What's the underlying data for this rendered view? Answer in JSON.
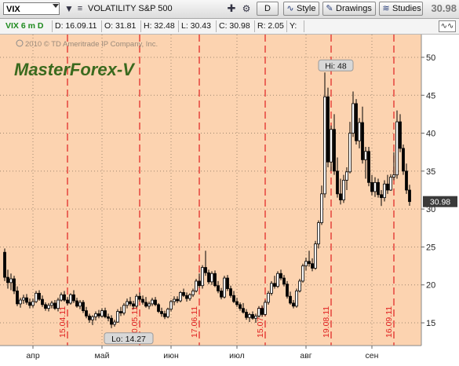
{
  "toolbar": {
    "symbol": "VIX",
    "description": "VOLATILITY S&P 500",
    "period_button": "D",
    "style_label": "Style",
    "drawings_label": "Drawings",
    "studies_label": "Studies",
    "last_price": "30.98"
  },
  "infobar": {
    "symbol_period": "VIX 6 m D",
    "date": "D: 16.09.11",
    "open": "O: 31.81",
    "high": "H: 32.48",
    "low": "L: 30.43",
    "close": "C: 30.98",
    "range": "R: 2.05",
    "y": "Y:"
  },
  "chart": {
    "copyright": "2010 © TD Ameritrade IP Company, Inc.",
    "watermark": "MasterForex-V",
    "colors": {
      "background": "#fcd3b0",
      "up": "#ffffff",
      "down": "#000000",
      "marker": "#e02020",
      "grid": "#a08870"
    },
    "y_ticks": [
      15,
      20,
      25,
      30,
      35,
      40,
      45,
      50
    ],
    "x_month_labels": [
      "апр",
      "май",
      "июн",
      "июл",
      "авг",
      "сен"
    ],
    "date_markers": [
      "15.04.11",
      "20.05.11",
      "17.06.11",
      "15.07.11",
      "19.08.11",
      "16.09.11"
    ],
    "high_label": "Hi: 48",
    "low_label": "Lo: 14.27",
    "price_tag": "30.98"
  },
  "chart_data": {
    "type": "candlestick",
    "ylim": [
      12,
      53
    ],
    "y_ticks": [
      15,
      20,
      25,
      30,
      35,
      40,
      45,
      50
    ],
    "x_labels": [
      "апр",
      "май",
      "июн",
      "июл",
      "авг",
      "сен"
    ],
    "series": [
      {
        "values": [
          [
            24.3,
            24.8,
            20.5,
            21.0
          ],
          [
            21.0,
            22.0,
            19.5,
            20.3
          ],
          [
            20.3,
            21.5,
            19.3,
            20.8
          ],
          [
            20.8,
            21.2,
            18.8,
            19.2
          ],
          [
            19.2,
            19.8,
            17.2,
            17.5
          ],
          [
            17.5,
            18.3,
            17.0,
            18.0
          ],
          [
            18.0,
            18.7,
            17.5,
            18.3
          ],
          [
            18.3,
            18.8,
            17.4,
            17.7
          ],
          [
            17.7,
            18.2,
            16.9,
            17.3
          ],
          [
            17.3,
            18.2,
            17.0,
            17.8
          ],
          [
            17.8,
            19.2,
            17.6,
            18.9
          ],
          [
            18.9,
            19.3,
            17.9,
            18.1
          ],
          [
            18.1,
            18.6,
            17.1,
            17.4
          ],
          [
            17.4,
            17.7,
            16.6,
            16.9
          ],
          [
            16.9,
            17.6,
            16.5,
            17.3
          ],
          [
            17.3,
            17.9,
            16.9,
            17.6
          ],
          [
            17.6,
            18.0,
            16.7,
            16.9
          ],
          [
            16.9,
            18.3,
            16.5,
            18.0
          ],
          [
            18.0,
            19.0,
            17.8,
            18.7
          ],
          [
            18.7,
            19.2,
            17.8,
            18.0
          ],
          [
            18.0,
            18.4,
            17.3,
            17.6
          ],
          [
            17.6,
            18.9,
            17.4,
            18.7
          ],
          [
            18.7,
            19.3,
            17.6,
            17.9
          ],
          [
            17.9,
            18.3,
            17.0,
            17.2
          ],
          [
            17.2,
            18.0,
            16.8,
            17.7
          ],
          [
            17.7,
            18.0,
            16.3,
            16.6
          ],
          [
            16.6,
            17.1,
            15.6,
            15.9
          ],
          [
            15.9,
            16.2,
            15.0,
            15.4
          ],
          [
            15.4,
            16.0,
            14.7,
            15.8
          ],
          [
            15.8,
            16.5,
            15.3,
            16.2
          ],
          [
            16.2,
            16.7,
            15.6,
            15.9
          ],
          [
            15.9,
            16.9,
            15.7,
            16.6
          ],
          [
            16.6,
            17.0,
            15.6,
            15.8
          ],
          [
            15.8,
            16.2,
            15.2,
            15.6
          ],
          [
            15.6,
            16.0,
            14.3,
            14.8
          ],
          [
            14.8,
            15.4,
            14.5,
            15.1
          ],
          [
            15.1,
            16.8,
            15.0,
            16.5
          ],
          [
            16.5,
            17.1,
            15.9,
            16.3
          ],
          [
            16.3,
            17.6,
            16.0,
            17.3
          ],
          [
            17.3,
            18.2,
            16.9,
            17.8
          ],
          [
            17.8,
            18.4,
            17.2,
            17.5
          ],
          [
            17.5,
            17.9,
            16.8,
            17.2
          ],
          [
            17.2,
            18.8,
            17.0,
            18.5
          ],
          [
            18.5,
            19.0,
            17.8,
            18.1
          ],
          [
            18.1,
            18.6,
            17.4,
            17.7
          ],
          [
            17.7,
            18.4,
            17.0,
            17.2
          ],
          [
            17.2,
            17.8,
            16.8,
            17.5
          ],
          [
            17.5,
            18.3,
            17.2,
            18.0
          ],
          [
            18.0,
            18.4,
            17.2,
            17.4
          ],
          [
            17.4,
            17.6,
            16.3,
            16.5
          ],
          [
            16.5,
            17.0,
            15.8,
            16.2
          ],
          [
            16.2,
            16.6,
            15.5,
            15.8
          ],
          [
            15.8,
            17.0,
            15.6,
            16.8
          ],
          [
            16.8,
            18.0,
            16.5,
            17.8
          ],
          [
            17.8,
            18.5,
            17.3,
            18.1
          ],
          [
            18.1,
            18.5,
            17.6,
            17.9
          ],
          [
            17.9,
            19.2,
            17.7,
            19.0
          ],
          [
            19.0,
            19.5,
            18.4,
            18.6
          ],
          [
            18.6,
            19.0,
            17.8,
            18.2
          ],
          [
            18.2,
            18.9,
            17.9,
            18.7
          ],
          [
            18.7,
            19.5,
            18.4,
            19.2
          ],
          [
            19.2,
            20.8,
            19.0,
            20.5
          ],
          [
            20.5,
            21.5,
            19.6,
            19.9
          ],
          [
            19.9,
            22.6,
            19.5,
            22.3
          ],
          [
            22.3,
            24.5,
            21.2,
            21.6
          ],
          [
            21.6,
            22.0,
            20.1,
            20.4
          ],
          [
            20.4,
            21.8,
            20.0,
            21.5
          ],
          [
            21.5,
            21.9,
            19.7,
            19.9
          ],
          [
            19.9,
            20.5,
            18.9,
            19.2
          ],
          [
            19.2,
            19.6,
            18.1,
            18.4
          ],
          [
            18.4,
            21.2,
            18.2,
            20.9
          ],
          [
            20.9,
            21.3,
            19.2,
            19.5
          ],
          [
            19.5,
            19.9,
            18.3,
            18.6
          ],
          [
            18.6,
            19.2,
            17.6,
            17.8
          ],
          [
            17.8,
            18.3,
            17.1,
            17.4
          ],
          [
            17.4,
            17.7,
            16.6,
            16.9
          ],
          [
            16.9,
            17.6,
            16.2,
            16.4
          ],
          [
            16.4,
            16.8,
            15.4,
            15.7
          ],
          [
            15.7,
            16.3,
            15.1,
            16.1
          ],
          [
            16.1,
            16.5,
            15.4,
            15.6
          ],
          [
            15.6,
            16.2,
            15.0,
            15.9
          ],
          [
            15.9,
            17.2,
            15.7,
            16.9
          ],
          [
            16.9,
            17.3,
            15.8,
            16.1
          ],
          [
            16.1,
            18.0,
            15.9,
            17.7
          ],
          [
            17.7,
            19.2,
            17.4,
            18.9
          ],
          [
            18.9,
            20.5,
            18.6,
            20.2
          ],
          [
            20.2,
            21.2,
            19.5,
            19.8
          ],
          [
            19.8,
            21.8,
            19.6,
            21.5
          ],
          [
            21.5,
            22.0,
            20.6,
            20.9
          ],
          [
            20.9,
            21.3,
            19.8,
            20.1
          ],
          [
            20.1,
            20.5,
            18.2,
            18.5
          ],
          [
            18.5,
            19.1,
            17.4,
            17.6
          ],
          [
            17.6,
            18.0,
            16.9,
            17.2
          ],
          [
            17.2,
            19.5,
            17.0,
            19.2
          ],
          [
            19.2,
            20.8,
            19.0,
            20.5
          ],
          [
            20.5,
            22.8,
            20.3,
            22.5
          ],
          [
            22.5,
            23.6,
            21.9,
            23.1
          ],
          [
            23.1,
            24.5,
            22.4,
            22.8
          ],
          [
            22.8,
            23.5,
            21.8,
            22.2
          ],
          [
            22.2,
            25.8,
            22.0,
            25.4
          ],
          [
            25.4,
            28.5,
            24.8,
            28.2
          ],
          [
            28.2,
            33.1,
            27.9,
            32.0
          ],
          [
            32.0,
            48.0,
            31.5,
            44.8
          ],
          [
            44.8,
            46.0,
            35.5,
            36.2
          ],
          [
            36.2,
            41.0,
            35.0,
            40.5
          ],
          [
            40.5,
            42.5,
            34.5,
            35.0
          ],
          [
            35.0,
            36.8,
            31.5,
            32.0
          ],
          [
            32.0,
            34.0,
            30.6,
            31.2
          ],
          [
            31.2,
            34.5,
            30.8,
            33.8
          ],
          [
            33.8,
            35.5,
            32.5,
            34.9
          ],
          [
            34.9,
            41.5,
            34.7,
            40.0
          ],
          [
            40.0,
            45.5,
            39.5,
            43.9
          ],
          [
            43.9,
            44.5,
            38.5,
            39.0
          ],
          [
            39.0,
            42.0,
            38.0,
            41.4
          ],
          [
            41.4,
            43.5,
            36.0,
            36.5
          ],
          [
            36.5,
            38.2,
            34.0,
            37.6
          ],
          [
            37.6,
            38.2,
            33.0,
            33.5
          ],
          [
            33.5,
            34.5,
            31.8,
            32.3
          ],
          [
            32.3,
            34.2,
            31.6,
            33.5
          ],
          [
            33.5,
            34.0,
            31.5,
            31.9
          ],
          [
            31.9,
            32.5,
            30.4,
            31.5
          ],
          [
            31.5,
            33.8,
            31.0,
            33.3
          ],
          [
            33.3,
            34.5,
            32.0,
            32.5
          ],
          [
            32.5,
            34.6,
            32.4,
            34.2
          ],
          [
            34.2,
            37.5,
            33.8,
            34.5
          ],
          [
            34.5,
            43.0,
            34.0,
            41.5
          ],
          [
            41.5,
            42.5,
            37.5,
            38.0
          ],
          [
            38.0,
            38.5,
            34.5,
            35.0
          ],
          [
            35.0,
            36.0,
            32.0,
            32.5
          ],
          [
            32.5,
            33.2,
            30.43,
            30.98
          ]
        ]
      }
    ]
  }
}
